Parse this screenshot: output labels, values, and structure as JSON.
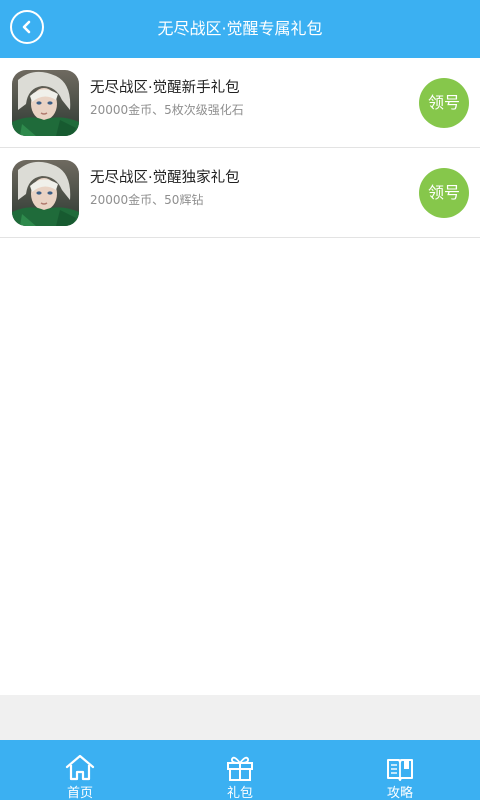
{
  "header": {
    "title": "无尽战区·觉醒专属礼包",
    "back_icon": "back-arrow-icon"
  },
  "gifts": [
    {
      "title": "无尽战区·觉醒新手礼包",
      "desc": "20000金币、5枚次级强化石",
      "button": "领号",
      "icon": "game-avatar-icon"
    },
    {
      "title": "无尽战区·觉醒独家礼包",
      "desc": "20000金币、50辉钻",
      "button": "领号",
      "icon": "game-avatar-icon"
    }
  ],
  "tabs": [
    {
      "label": "首页",
      "icon": "home-icon"
    },
    {
      "label": "礼包",
      "icon": "gift-icon"
    },
    {
      "label": "攻略",
      "icon": "book-icon"
    }
  ],
  "colors": {
    "primary": "#3bb0f2",
    "claim": "#86c74b",
    "desc": "#8f8f8f",
    "divider": "#e3e3e3",
    "bottom_strip": "#f0f0f0"
  }
}
